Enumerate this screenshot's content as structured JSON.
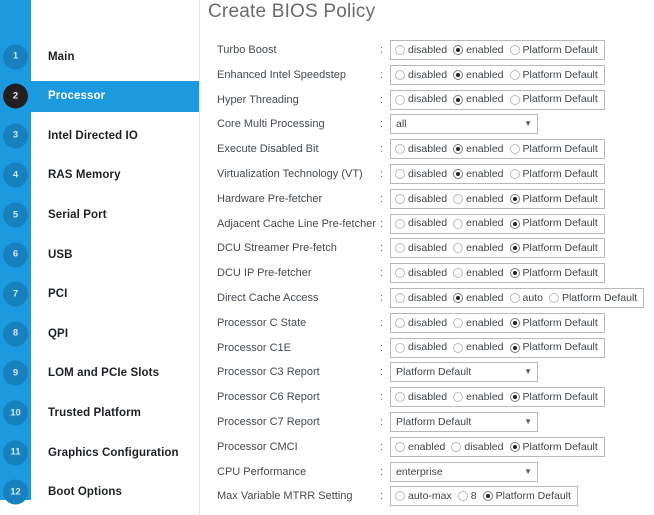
{
  "header": {
    "title": "Create BIOS Policy"
  },
  "sidebar": {
    "items": [
      {
        "num": "1",
        "label": "Main",
        "active": false
      },
      {
        "num": "2",
        "label": "Processor",
        "active": true
      },
      {
        "num": "3",
        "label": "Intel Directed IO",
        "active": false
      },
      {
        "num": "4",
        "label": "RAS Memory",
        "active": false
      },
      {
        "num": "5",
        "label": "Serial Port",
        "active": false
      },
      {
        "num": "6",
        "label": "USB",
        "active": false
      },
      {
        "num": "7",
        "label": "PCI",
        "active": false
      },
      {
        "num": "8",
        "label": "QPI",
        "active": false
      },
      {
        "num": "9",
        "label": "LOM and PCIe Slots",
        "active": false
      },
      {
        "num": "10",
        "label": "Trusted Platform",
        "active": false
      },
      {
        "num": "11",
        "label": "Graphics Configuration",
        "active": false
      },
      {
        "num": "12",
        "label": "Boot Options",
        "active": false
      }
    ]
  },
  "colors": {
    "accent_blue": "#1b9ae0",
    "badge_blue": "#1681bd",
    "active_badge": "#231f20",
    "title_gray": "#6b6b6b"
  },
  "form": {
    "separator": ":",
    "rows": [
      {
        "label": "Turbo Boost",
        "type": "radio",
        "options": [
          {
            "text": "disabled",
            "selected": false
          },
          {
            "text": "enabled",
            "selected": true
          },
          {
            "text": "Platform Default",
            "selected": false
          }
        ]
      },
      {
        "label": "Enhanced Intel Speedstep",
        "type": "radio",
        "options": [
          {
            "text": "disabled",
            "selected": false
          },
          {
            "text": "enabled",
            "selected": true
          },
          {
            "text": "Platform Default",
            "selected": false
          }
        ]
      },
      {
        "label": "Hyper Threading",
        "type": "radio",
        "options": [
          {
            "text": "disabled",
            "selected": false
          },
          {
            "text": "enabled",
            "selected": true
          },
          {
            "text": "Platform Default",
            "selected": false
          }
        ]
      },
      {
        "label": "Core Multi Processing",
        "type": "select",
        "value": "all"
      },
      {
        "label": "Execute Disabled Bit",
        "type": "radio",
        "options": [
          {
            "text": "disabled",
            "selected": false
          },
          {
            "text": "enabled",
            "selected": true
          },
          {
            "text": "Platform Default",
            "selected": false
          }
        ]
      },
      {
        "label": "Virtualization Technology (VT)",
        "type": "radio",
        "options": [
          {
            "text": "disabled",
            "selected": false
          },
          {
            "text": "enabled",
            "selected": true
          },
          {
            "text": "Platform Default",
            "selected": false
          }
        ]
      },
      {
        "label": "Hardware Pre-fetcher",
        "type": "radio",
        "options": [
          {
            "text": "disabled",
            "selected": false
          },
          {
            "text": "enabled",
            "selected": false
          },
          {
            "text": "Platform Default",
            "selected": true
          }
        ]
      },
      {
        "label": "Adjacent Cache Line Pre-fetcher",
        "type": "radio",
        "options": [
          {
            "text": "disabled",
            "selected": false
          },
          {
            "text": "enabled",
            "selected": false
          },
          {
            "text": "Platform Default",
            "selected": true
          }
        ]
      },
      {
        "label": "DCU Streamer Pre-fetch",
        "type": "radio",
        "options": [
          {
            "text": "disabled",
            "selected": false
          },
          {
            "text": "enabled",
            "selected": false
          },
          {
            "text": "Platform Default",
            "selected": true
          }
        ]
      },
      {
        "label": "DCU IP Pre-fetcher",
        "type": "radio",
        "options": [
          {
            "text": "disabled",
            "selected": false
          },
          {
            "text": "enabled",
            "selected": false
          },
          {
            "text": "Platform Default",
            "selected": true
          }
        ]
      },
      {
        "label": "Direct Cache Access",
        "type": "radio",
        "options": [
          {
            "text": "disabled",
            "selected": false
          },
          {
            "text": "enabled",
            "selected": true
          },
          {
            "text": "auto",
            "selected": false
          },
          {
            "text": "Platform Default",
            "selected": false
          }
        ]
      },
      {
        "label": "Processor C State",
        "type": "radio",
        "options": [
          {
            "text": "disabled",
            "selected": false
          },
          {
            "text": "enabled",
            "selected": false
          },
          {
            "text": "Platform Default",
            "selected": true
          }
        ]
      },
      {
        "label": "Processor C1E",
        "type": "radio",
        "options": [
          {
            "text": "disabled",
            "selected": false
          },
          {
            "text": "enabled",
            "selected": false
          },
          {
            "text": "Platform Default",
            "selected": true
          }
        ]
      },
      {
        "label": "Processor C3 Report",
        "type": "select",
        "value": "Platform Default"
      },
      {
        "label": "Processor C6 Report",
        "type": "radio",
        "options": [
          {
            "text": "disabled",
            "selected": false
          },
          {
            "text": "enabled",
            "selected": false
          },
          {
            "text": "Platform Default",
            "selected": true
          }
        ]
      },
      {
        "label": "Processor C7 Report",
        "type": "select",
        "value": "Platform Default"
      },
      {
        "label": "Processor CMCI",
        "type": "radio",
        "options": [
          {
            "text": "enabled",
            "selected": false
          },
          {
            "text": "disabled",
            "selected": false
          },
          {
            "text": "Platform Default",
            "selected": true
          }
        ]
      },
      {
        "label": "CPU Performance",
        "type": "select",
        "value": "enterprise"
      },
      {
        "label": "Max Variable MTRR Setting",
        "type": "radio",
        "options": [
          {
            "text": "auto-max",
            "selected": false
          },
          {
            "text": "8",
            "selected": false
          },
          {
            "text": "Platform Default",
            "selected": true
          }
        ]
      }
    ],
    "select_arrow_icon": "▼"
  }
}
